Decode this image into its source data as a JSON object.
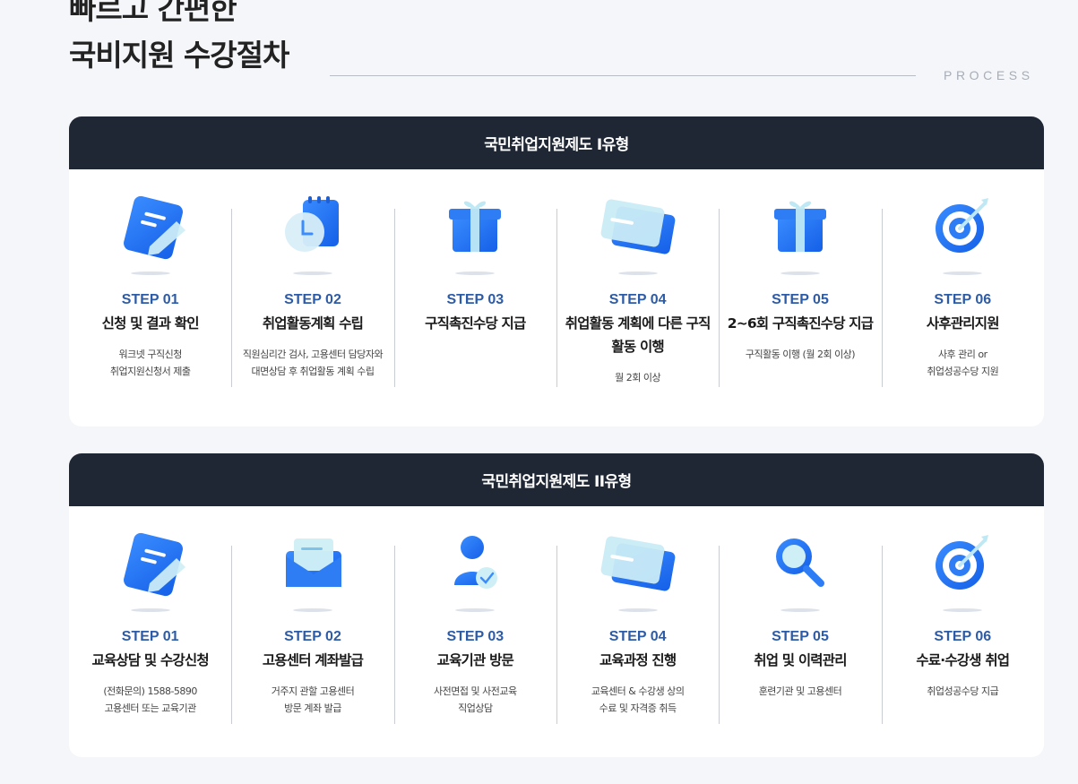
{
  "header": {
    "line1": "빠르고 간편한",
    "line2": "국비지원 수강절차",
    "process_label": "PROCESS"
  },
  "sections": [
    {
      "title": "국민취업지원제도 I유형",
      "steps": [
        {
          "icon": "note-pen-icon",
          "no": "STEP 01",
          "title": "신청 및 결과 확인",
          "desc": [
            "워크넷 구직신청",
            "취업지원신청서 제출"
          ]
        },
        {
          "icon": "calendar-clock-icon",
          "no": "STEP 02",
          "title": "취업활동계획 수립",
          "desc": [
            "직원심리간 검사, 고용센터 담당자와",
            "대면상담 후 취업활동 계획 수립"
          ]
        },
        {
          "icon": "gift-box-icon",
          "no": "STEP 03",
          "title": "구직촉진수당 지급",
          "desc": []
        },
        {
          "icon": "credit-cards-icon",
          "no": "STEP 04",
          "title": "취업활동 계획에 다른 구직활동 이행",
          "desc": [
            "월 2회 이상"
          ]
        },
        {
          "icon": "gift-box-icon",
          "no": "STEP 05",
          "title": "2~6회 구직촉진수당 지급",
          "desc": [
            "구직활동 이행 (월 2회 이상)"
          ]
        },
        {
          "icon": "target-icon",
          "no": "STEP 06",
          "title": "사후관리지원",
          "desc": [
            "사후 관리 or",
            "취업성공수당 지원"
          ]
        }
      ]
    },
    {
      "title": "국민취업지원제도 II유형",
      "steps": [
        {
          "icon": "note-pen-icon",
          "no": "STEP 01",
          "title": "교육상담 및 수강신청",
          "desc": [
            "(전화문의) 1588-5890",
            "고용센터 또는 교육기관"
          ]
        },
        {
          "icon": "mail-envelope-icon",
          "no": "STEP 02",
          "title": "고용센터 계좌발급",
          "desc": [
            "거주지 관할 고용센터",
            "방문 계좌 발급"
          ]
        },
        {
          "icon": "user-check-icon",
          "no": "STEP 03",
          "title": "교육기관 방문",
          "desc": [
            "사전면접 및 사전교육",
            "직업상담"
          ]
        },
        {
          "icon": "credit-cards-icon",
          "no": "STEP 04",
          "title": "교육과정 진행",
          "desc": [
            "교육센터 & 수강생 상의",
            "수료 및 자격증 취득"
          ]
        },
        {
          "icon": "magnifier-icon",
          "no": "STEP 05",
          "title": "취업 및 이력관리",
          "desc": [
            "훈련기관 및 고용센터"
          ]
        },
        {
          "icon": "target-icon",
          "no": "STEP 06",
          "title": "수료·수강생 취업",
          "desc": [
            "취업성공수당 지급"
          ]
        }
      ]
    }
  ]
}
